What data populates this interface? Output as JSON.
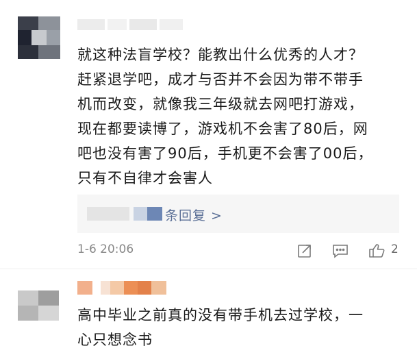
{
  "comments": [
    {
      "text": "就这种法盲学校？能教出什么优秀的人才？\n赶紧退学吧，成才与否并不会因为带不带手\n机而改变，就像我三年级就去网吧打游戏，\n现在都要读博了，游戏机不会害了80后，网\n吧也没有害了90后，手机更不会害了00后，\n只有不自律才会害人",
      "reply_label": "条回复 >",
      "timestamp": "1-6 20:06",
      "like_count": "2",
      "icons": [
        "share-icon",
        "comment-icon",
        "like-icon"
      ]
    },
    {
      "text": "高中毕业之前真的没有带手机去过学校，一\n心只想念书"
    }
  ],
  "colors": {
    "link": "#5a6f96",
    "meta": "#888888",
    "icon": "#7a7a7a",
    "reply_bg": "#f6f6f6"
  }
}
